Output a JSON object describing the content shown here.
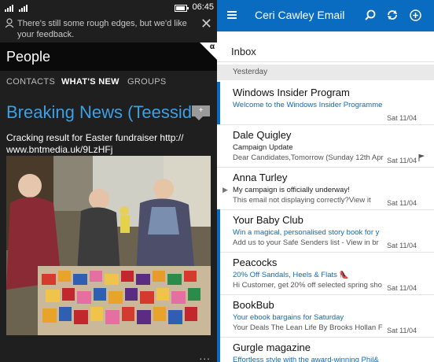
{
  "left": {
    "status": {
      "time": "06:45"
    },
    "toast": {
      "text": "There's still some rough edges, but we'd like your feedback."
    },
    "title": "People",
    "badge": "α",
    "tabs": [
      "CONTACTS",
      "WHAT'S NEW",
      "GROUPS"
    ],
    "headline": "Breaking News (Teesside)",
    "comment_count": "+",
    "post": {
      "line1": "Cracking result for Easter fundraiser http://",
      "line2": "www.bntmedia.uk/9LzHFj"
    },
    "more": "..."
  },
  "right": {
    "app_title": "Ceri Cawley Email",
    "folder": "Inbox",
    "group": "Yesterday",
    "messages": [
      {
        "from": "Windows Insider Program",
        "subject": "Welcome to the Windows Insider Programme",
        "preview": "",
        "date": "Sat 11/04",
        "unread": true,
        "subject_blue": true,
        "flag": false,
        "caret": false
      },
      {
        "from": "Dale Quigley",
        "subject": "Campaign Update",
        "preview": "Dear Candidates,Tomorrow (Sunday 12th Apr",
        "date": "Sat 11/04",
        "unread": false,
        "subject_blue": false,
        "flag": true,
        "caret": false
      },
      {
        "from": "Anna Turley",
        "subject": "My campaign is officially underway!",
        "preview": "This email not displaying correctly?View it",
        "date": "Sat 11/04",
        "unread": false,
        "subject_blue": false,
        "flag": false,
        "caret": true
      },
      {
        "from": "Your Baby Club",
        "subject": "Win a magical, personalised story book for y",
        "preview": "Add us to your Safe Senders list - View in br",
        "date": "Sat 11/04",
        "unread": true,
        "subject_blue": true,
        "flag": false,
        "caret": false
      },
      {
        "from": "Peacocks",
        "subject": "20% Off Sandals, Heels & Flats 👠",
        "preview": "Hi Customer, get 20% off selected spring sho",
        "date": "Sat 11/04",
        "unread": true,
        "subject_blue": true,
        "flag": false,
        "caret": false
      },
      {
        "from": "BookBub",
        "subject": "Your ebook bargains for Saturday",
        "preview": "Your Deals The Lean Life By Brooks Hollan F",
        "date": "Sat 11/04",
        "unread": true,
        "subject_blue": true,
        "flag": false,
        "caret": false
      },
      {
        "from": "Gurgle magazine",
        "subject": "Effortless style with the award-winning Phil&",
        "preview": "",
        "date": "",
        "unread": true,
        "subject_blue": true,
        "flag": false,
        "caret": false
      }
    ]
  },
  "colors": {
    "accent": "#0a6cc1",
    "headline": "#3ba0e6",
    "dark_bg": "#1f1f1f"
  }
}
